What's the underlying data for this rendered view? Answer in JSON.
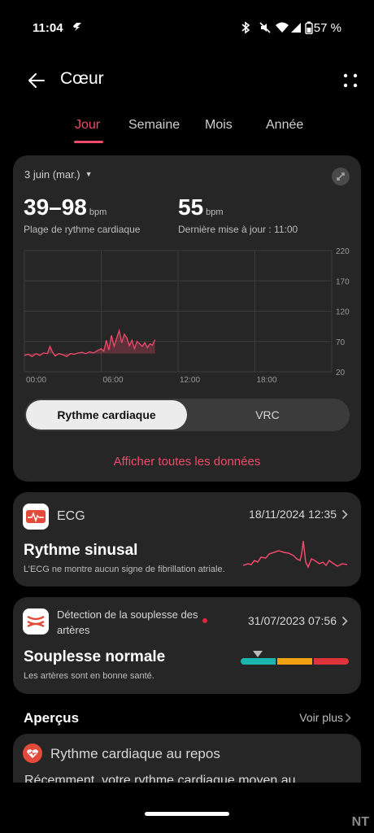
{
  "status_bar": {
    "time": "11:04",
    "battery_pct": "57 %"
  },
  "header": {
    "title": "Cœur"
  },
  "tabs": [
    {
      "label": "Jour",
      "active": true
    },
    {
      "label": "Semaine",
      "active": false
    },
    {
      "label": "Mois",
      "active": false
    },
    {
      "label": "Année",
      "active": false
    }
  ],
  "summary": {
    "date": "3 juin (mar.)",
    "range_value": "39–98",
    "range_unit": "bpm",
    "range_label": "Plage de rythme cardiaque",
    "last_value": "55",
    "last_unit": "bpm",
    "last_label": "Dernière mise à jour : 11:00"
  },
  "chart_data": {
    "type": "line",
    "x_ticks": [
      "00:00",
      "06:00",
      "12:00",
      "18:00"
    ],
    "y_ticks": [
      220,
      170,
      120,
      70,
      20
    ],
    "ylim": [
      20,
      220
    ],
    "xlim": [
      0,
      24
    ],
    "color": "#f04a6a",
    "series": [
      {
        "x": [
          0,
          0.3,
          0.6,
          0.9,
          1.2,
          1.5,
          1.8,
          2.0,
          2.2,
          2.4,
          2.7,
          3.0,
          3.3,
          3.6,
          3.9,
          4.2,
          4.5,
          4.8,
          5.1,
          5.4,
          5.7,
          6.0,
          6.2,
          6.4,
          6.6,
          6.8,
          7.0,
          7.2,
          7.4,
          7.6,
          7.8,
          8.0,
          8.2,
          8.4,
          8.6,
          8.8,
          9.0,
          9.2,
          9.4,
          9.6,
          9.8,
          10.0,
          10.2
        ],
        "y": [
          47,
          49,
          45,
          50,
          47,
          51,
          50,
          62,
          52,
          46,
          50,
          48,
          45,
          50,
          49,
          51,
          52,
          50,
          53,
          51,
          55,
          58,
          54,
          72,
          56,
          80,
          62,
          75,
          88,
          68,
          82,
          76,
          63,
          72,
          58,
          70,
          66,
          62,
          68,
          60,
          66,
          64,
          73
        ]
      }
    ]
  },
  "toggle": {
    "left": "Rythme cardiaque",
    "right": "VRC"
  },
  "show_all": "Afficher toutes les données",
  "ecg": {
    "title": "ECG",
    "date": "18/11/2024 12:35",
    "result": "Rythme sinusal",
    "detail": "L’ECG ne montre aucun signe de fibrillation atriale."
  },
  "arteries": {
    "title": "Détection de la souplesse des artères",
    "date": "31/07/2023 07:56",
    "result": "Souplesse normale",
    "detail": "Les artères sont en bonne santé.",
    "level_fraction": 0.16,
    "bar_colors": [
      "#1cb5ad",
      "#f0a212",
      "#e0323a"
    ]
  },
  "overview": {
    "title": "Aperçus",
    "see_more": "Voir plus"
  },
  "resting": {
    "title": "Rythme cardiaque au repos",
    "text": "Récemment, votre rythme cardiaque moyen au"
  },
  "watermark": "NT"
}
